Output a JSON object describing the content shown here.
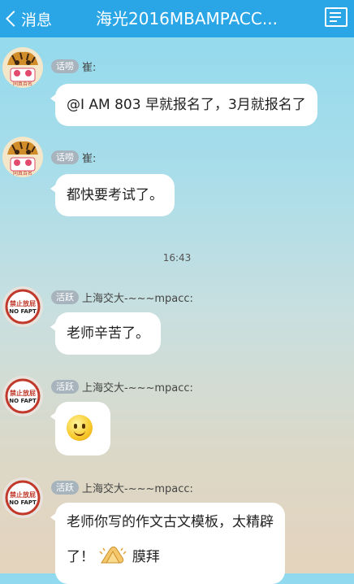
{
  "header": {
    "back_label": "消息",
    "title": "海光2016MBAMPACC...",
    "menu_icon": "list-icon"
  },
  "colors": {
    "header_bg": "#2aa6e6",
    "bubble_bg": "#ffffff",
    "badge_bg": "#a7b4bd"
  },
  "messages": [
    {
      "badge": "话唠",
      "sender": "崔:",
      "text": "@I AM 803 早就报名了，3月就报名了",
      "avatar": "tiger-avatar"
    },
    {
      "badge": "话唠",
      "sender": "崔:",
      "text": "都快要考试了。",
      "avatar": "tiger-avatar"
    },
    {
      "badge": "活跃",
      "sender": "上海交大-~~~mpacc:",
      "text": "老师辛苦了。",
      "avatar": "no-fapt-avatar"
    },
    {
      "badge": "活跃",
      "sender": "上海交大-~~~mpacc:",
      "text": "",
      "emoji": "smiley-icon",
      "avatar": "no-fapt-avatar"
    },
    {
      "badge": "活跃",
      "sender": "上海交大-~~~mpacc:",
      "text_line1": "老师你写的作文古文模板，太精辟",
      "text_line2_start": "了！",
      "text_line2_end": "膜拜",
      "emoji": "praying-hands-icon",
      "avatar": "no-fapt-avatar"
    }
  ],
  "timestamp": "16:43",
  "avatar_text": {
    "tiger": "同真百名",
    "nofapt_top": "禁止放屁",
    "nofapt_bottom": "NO FAPT"
  }
}
